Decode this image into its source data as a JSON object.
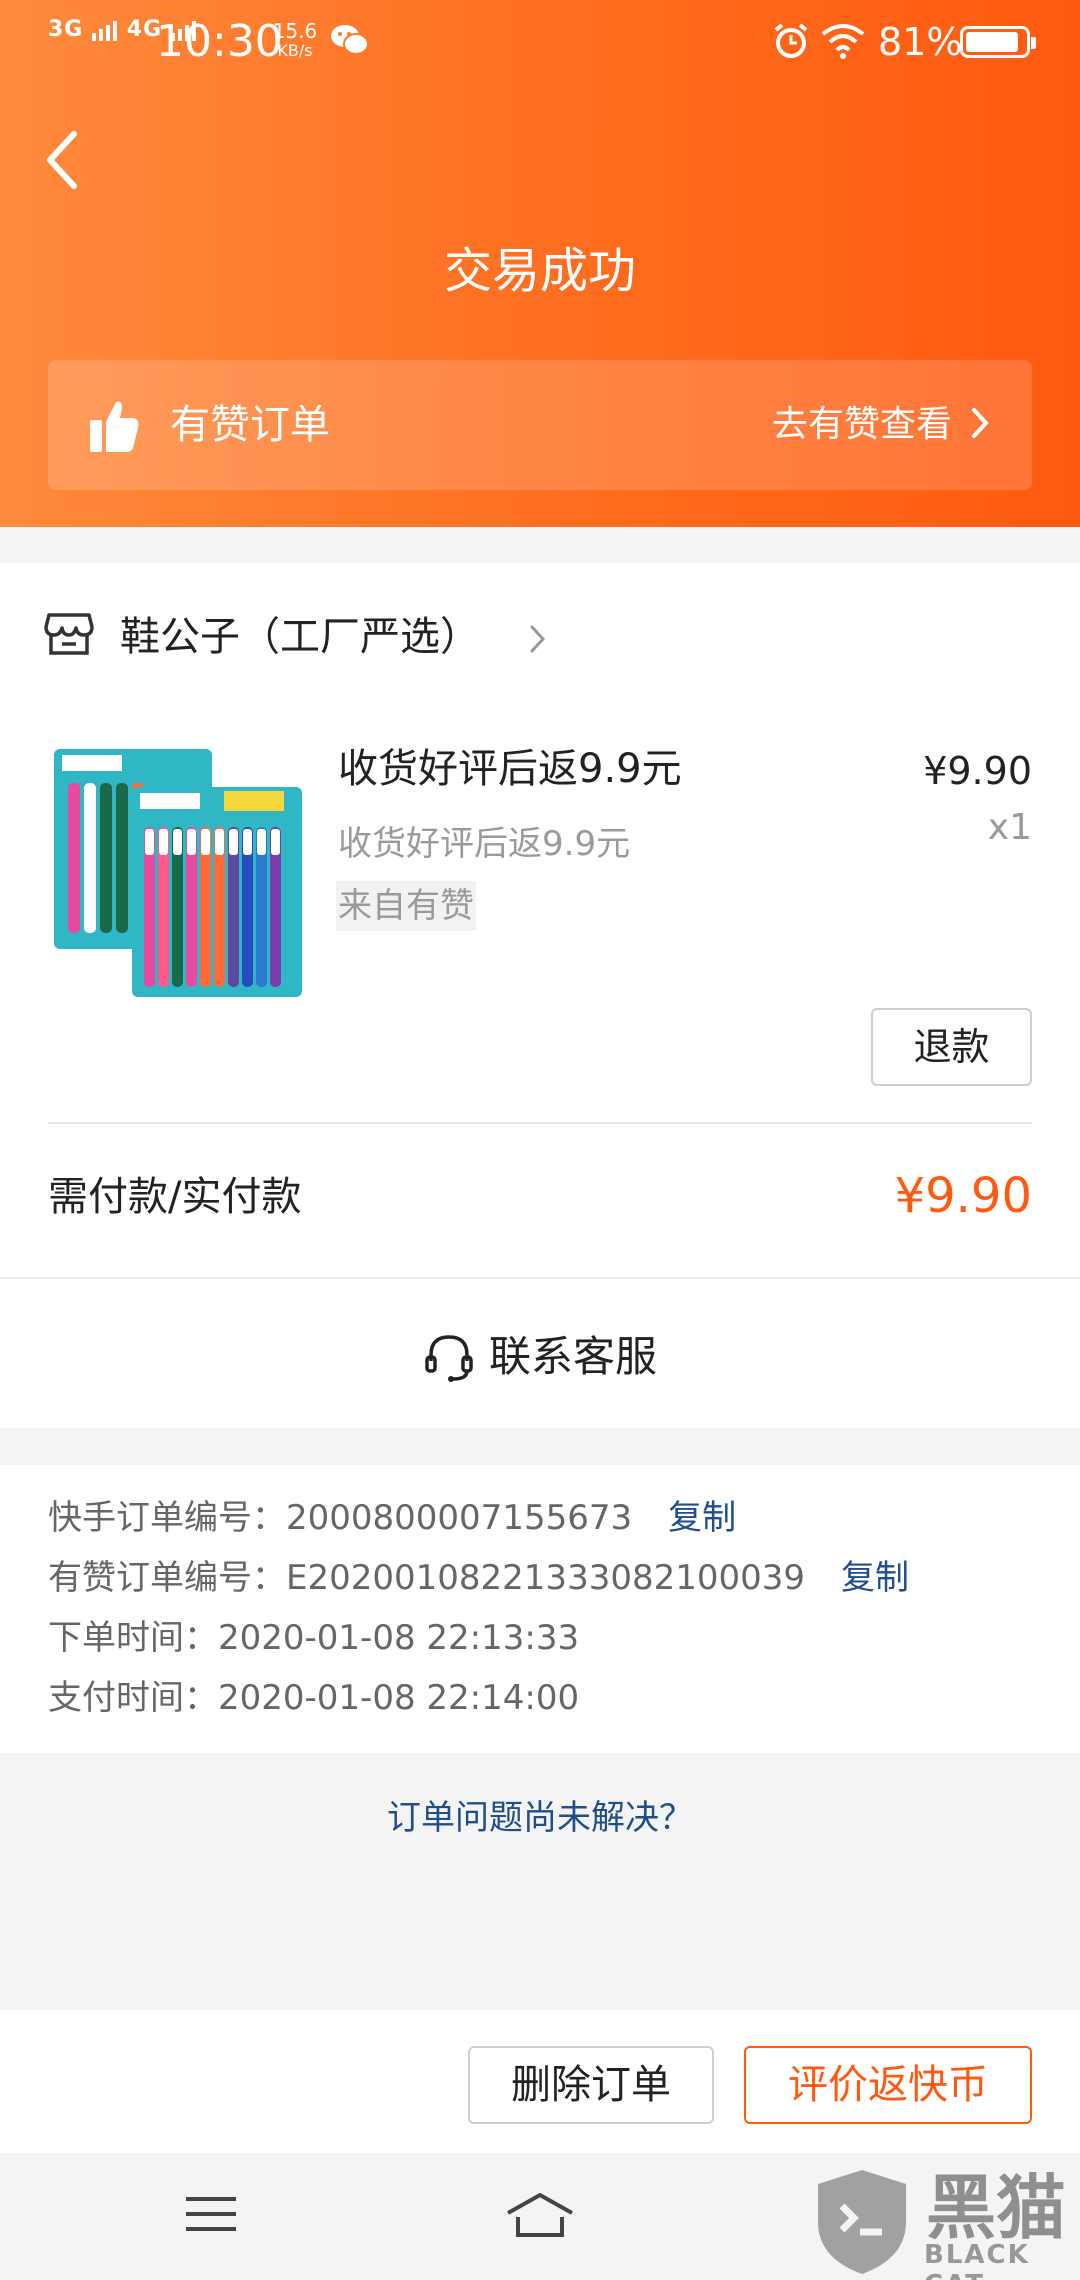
{
  "status_bar": {
    "network_1": "3G",
    "network_2": "4G",
    "time": "10:30",
    "speed_value": "15.6",
    "speed_unit": "KB/s",
    "battery": "81%"
  },
  "header": {
    "title": "交易成功",
    "banner_label": "有赞订单",
    "banner_link": "去有赞查看"
  },
  "shop": {
    "name": "鞋公子（工厂严选）"
  },
  "product": {
    "title": "收货好评后返9.9元",
    "subtitle": "收货好评后返9.9元",
    "source_tag": "来自有赞",
    "price": "¥9.90",
    "quantity": "x1",
    "refund_label": "退款"
  },
  "payment": {
    "label": "需付款/实付款",
    "amount": "¥9.90"
  },
  "contact": {
    "label": "联系客服"
  },
  "order_info": {
    "kuaishou_no_label": "快手订单编号：",
    "kuaishou_no": "2000800007155673",
    "youzan_no_label": "有赞订单编号：",
    "youzan_no": "E20200108221333082100039",
    "copy_label": "复制",
    "order_time_label": "下单时间：",
    "order_time": "2020-01-08 22:13:33",
    "pay_time_label": "支付时间：",
    "pay_time": "2020-01-08 22:14:00"
  },
  "unresolved_link": "订单问题尚未解决？",
  "actions": {
    "delete": "删除订单",
    "review": "评价返快币"
  },
  "watermark": {
    "text": "黑猫",
    "sub": "BLACK CAT"
  },
  "colors": {
    "accent": "#ff5a10",
    "link": "#1f4e8c"
  }
}
